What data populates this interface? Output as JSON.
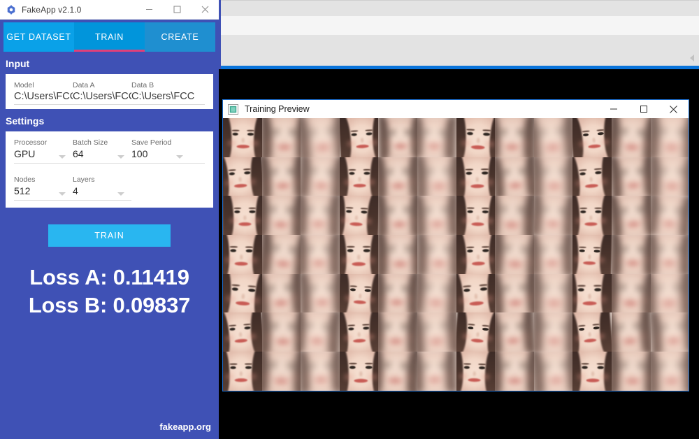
{
  "app_window": {
    "title": "FakeApp v2.1.0",
    "icon": "fakeapp-hex-icon",
    "accent_blue": "#3f51b5",
    "tab_active_underline": "#e0407a",
    "controls": {
      "minimize": "minimize-icon",
      "maximize": "maximize-icon",
      "close": "close-icon"
    },
    "tabs": [
      {
        "label": "GET DATASET",
        "active": false
      },
      {
        "label": "TRAIN",
        "active": true
      },
      {
        "label": "CREATE",
        "active": false
      }
    ],
    "input_section": {
      "title": "Input",
      "fields": [
        {
          "label": "Model",
          "value": "C:\\Users\\FCCC"
        },
        {
          "label": "Data A",
          "value": "C:\\Users\\FCCC"
        },
        {
          "label": "Data B",
          "value": "C:\\Users\\FCC"
        }
      ]
    },
    "settings_section": {
      "title": "Settings",
      "row1": [
        {
          "label": "Processor",
          "value": "GPU"
        },
        {
          "label": "Batch Size",
          "value": "64"
        },
        {
          "label": "Save Period",
          "value": "100"
        }
      ],
      "row2": [
        {
          "label": "Nodes",
          "value": "512"
        },
        {
          "label": "Layers",
          "value": "4"
        }
      ]
    },
    "train_button": {
      "label": "TRAIN",
      "color": "#29b6f0"
    },
    "loss": {
      "a_label": "Loss A:",
      "a_value": "0.11419",
      "b_label": "Loss B:",
      "b_value": "0.09837",
      "a_line": "Loss A: 0.11419",
      "b_line": "Loss B: 0.09837"
    },
    "footer": "fakeapp.org"
  },
  "preview_window": {
    "title": "Training Preview",
    "icon": "image-thumbnail-icon",
    "border_color": "#1a6fd4",
    "controls": {
      "minimize": "minimize-icon",
      "maximize": "maximize-icon",
      "close": "close-icon"
    },
    "grid": {
      "columns": 12,
      "rows": 7,
      "cell_pattern": [
        "original",
        "recon",
        "recon2"
      ],
      "description": "Face training preview grid: each triplet shows the source face followed by two blurred autoencoder reconstructions."
    }
  },
  "background_window": {
    "chevron_icon": "chevron-left-icon",
    "rule_color": "#0a74da"
  },
  "desktop": {
    "background": "#000000"
  }
}
